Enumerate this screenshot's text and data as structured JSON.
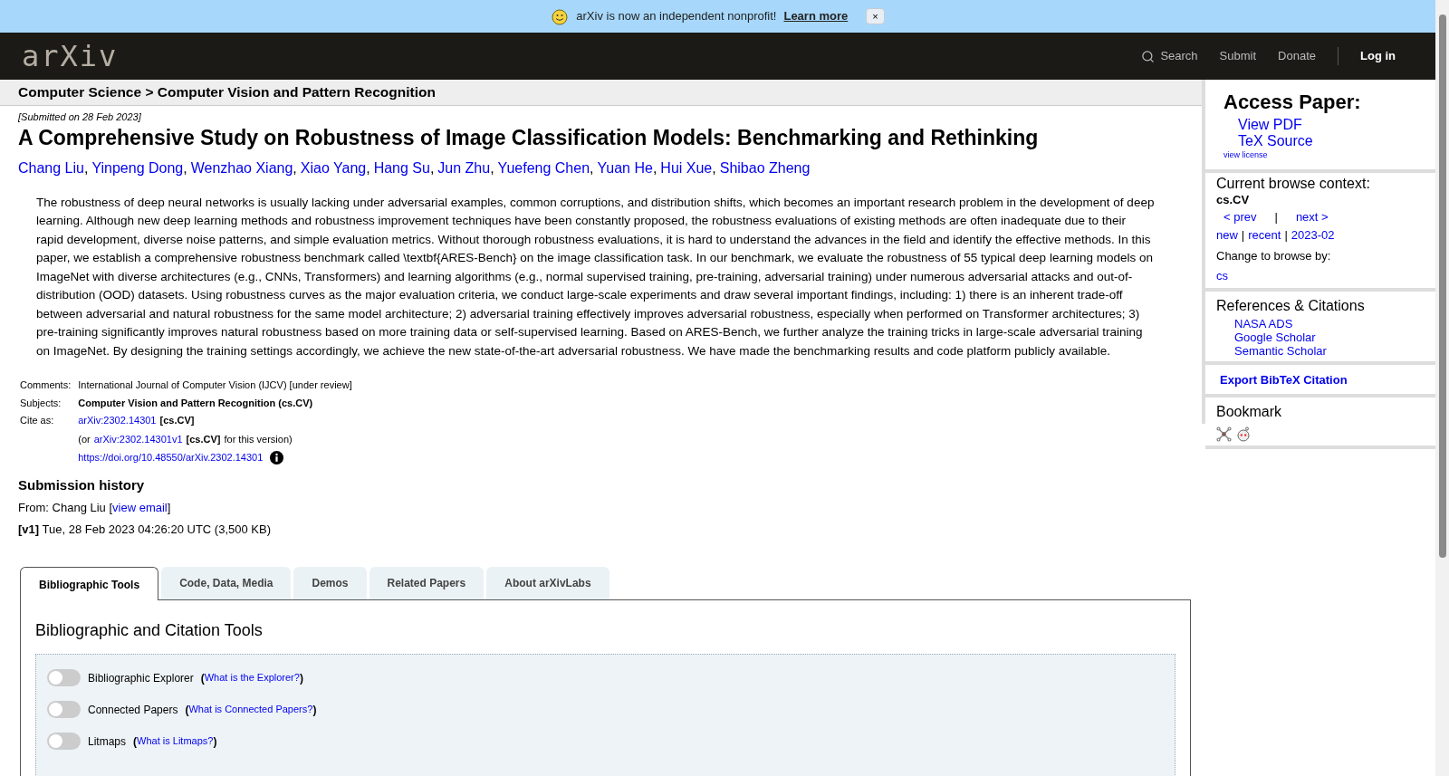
{
  "banner": {
    "message": "arXiv is now an independent nonprofit!",
    "link": "Learn more",
    "close": "×"
  },
  "header": {
    "logo": "arXiv",
    "nav": [
      "Search",
      "Submit",
      "Donate"
    ],
    "login": "Log in"
  },
  "breadcrumb": "Computer Science > Computer Vision and Pattern Recognition",
  "submitted": "[Submitted on 28 Feb 2023]",
  "title": "A Comprehensive Study on Robustness of Image Classification Models: Benchmarking and Rethinking",
  "authors": [
    {
      "name": "Chang Liu",
      "sep": ","
    },
    {
      "name": "Yinpeng Dong",
      "sep": ","
    },
    {
      "name": "Wenzhao Xiang",
      "sep": ","
    },
    {
      "name": "Xiao Yang",
      "sep": ","
    },
    {
      "name": "Hang Su",
      "sep": ","
    },
    {
      "name": "Jun Zhu",
      "sep": ","
    },
    {
      "name": "Yuefeng Chen",
      "sep": ","
    },
    {
      "name": "Yuan He",
      "sep": ","
    },
    {
      "name": "Hui Xue",
      "sep": ","
    },
    {
      "name": "Shibao Zheng"
    }
  ],
  "abstract": "The robustness of deep neural networks is usually lacking under adversarial examples, common corruptions, and distribution shifts, which becomes an important research problem in the development of deep learning. Although new deep learning methods and robustness improvement techniques have been constantly proposed, the robustness evaluations of existing methods are often inadequate due to their rapid development, diverse noise patterns, and simple evaluation metrics. Without thorough robustness evaluations, it is hard to understand the advances in the field and identify the effective methods. In this paper, we establish a comprehensive robustness benchmark called \\textbf{ARES-Bench} on the image classification task. In our benchmark, we evaluate the robustness of 55 typical deep learning models on ImageNet with diverse architectures (e.g., CNNs, Transformers) and learning algorithms (e.g., normal supervised training, pre-training, adversarial training) under numerous adversarial attacks and out-of-distribution (OOD) datasets. Using robustness curves as the major evaluation criteria, we conduct large-scale experiments and draw several important findings, including: 1) there is an inherent trade-off between adversarial and natural robustness for the same model architecture; 2) adversarial training effectively improves adversarial robustness, especially when performed on Transformer architectures; 3) pre-training significantly improves natural robustness based on more training data or self-supervised learning. Based on ARES-Bench, we further analyze the training tricks in large-scale adversarial training on ImageNet. By designing the training settings accordingly, we achieve the new state-of-the-art adversarial robustness. We have made the benchmarking results and code platform publicly available.",
  "metadata": [
    {
      "label": "Comments:",
      "lines": [
        [
          {
            "kind": "text",
            "text": "International Journal of Computer Vision (IJCV) [under review]"
          }
        ]
      ]
    },
    {
      "label": "Subjects:",
      "lines": [
        [
          {
            "kind": "bold",
            "text": "Computer Vision and Pattern Recognition (cs.CV)"
          }
        ]
      ]
    },
    {
      "label": "Cite as:",
      "lines": [
        [
          {
            "kind": "link",
            "text": "arXiv:2302.14301"
          },
          {
            "kind": "bold",
            "text": "[cs.CV]"
          }
        ],
        [
          {
            "kind": "text",
            "text": "(or"
          },
          {
            "kind": "link",
            "text": "arXiv:2302.14301v1"
          },
          {
            "kind": "bold",
            "text": "[cs.CV]"
          },
          {
            "kind": "text",
            "text": "for this version)"
          }
        ],
        [
          {
            "kind": "link",
            "text": "https://doi.org/10.48550/arXiv.2302.14301"
          },
          {
            "kind": "info"
          }
        ]
      ]
    }
  ],
  "history": {
    "heading": "Submission history",
    "from": [
      {
        "kind": "text",
        "text": "From: Chang Liu ["
      },
      {
        "kind": "link",
        "text": "view email"
      },
      {
        "kind": "text",
        "text": "]"
      }
    ],
    "versions": [
      {
        "version": "[v1]",
        "text": "Tue, 28 Feb 2023 04:26:20 UTC (3,500 KB)"
      }
    ]
  },
  "tabs": [
    {
      "label": "Bibliographic Tools",
      "selected": true
    },
    {
      "label": "Code, Data, Media",
      "selected": false
    },
    {
      "label": "Demos",
      "selected": false
    },
    {
      "label": "Related Papers",
      "selected": false
    },
    {
      "label": "About arXivLabs",
      "selected": false
    }
  ],
  "tools": {
    "heading": "Bibliographic and Citation Tools",
    "items": [
      {
        "name": "Bibliographic Explorer",
        "open": "(",
        "link": "What is the Explorer?",
        "close": ")",
        "checked": false
      },
      {
        "name": "Connected Papers",
        "open": "(",
        "link": "What is Connected Papers?",
        "close": ")",
        "checked": false
      },
      {
        "name": "Litmaps",
        "open": "(",
        "link": "What is Litmaps?",
        "close": ")",
        "checked": false
      }
    ]
  },
  "sidebar": {
    "access": {
      "heading": "Access Paper:",
      "links": [
        "View PDF",
        "TeX Source"
      ],
      "license": "view license"
    },
    "browse": {
      "heading": "Current browse context:",
      "context": "cs.CV",
      "prev": "< prev",
      "sep": "|",
      "next": "next >",
      "links": [
        "new",
        "recent",
        "2023-02"
      ],
      "change": "Change to browse by:",
      "by": [
        "cs"
      ]
    },
    "refs": {
      "heading": "References & Citations",
      "links": [
        "NASA ADS",
        "Google Scholar",
        "Semantic Scholar"
      ]
    },
    "export": "Export BibTeX Citation",
    "bookmark": {
      "heading": "Bookmark"
    }
  }
}
